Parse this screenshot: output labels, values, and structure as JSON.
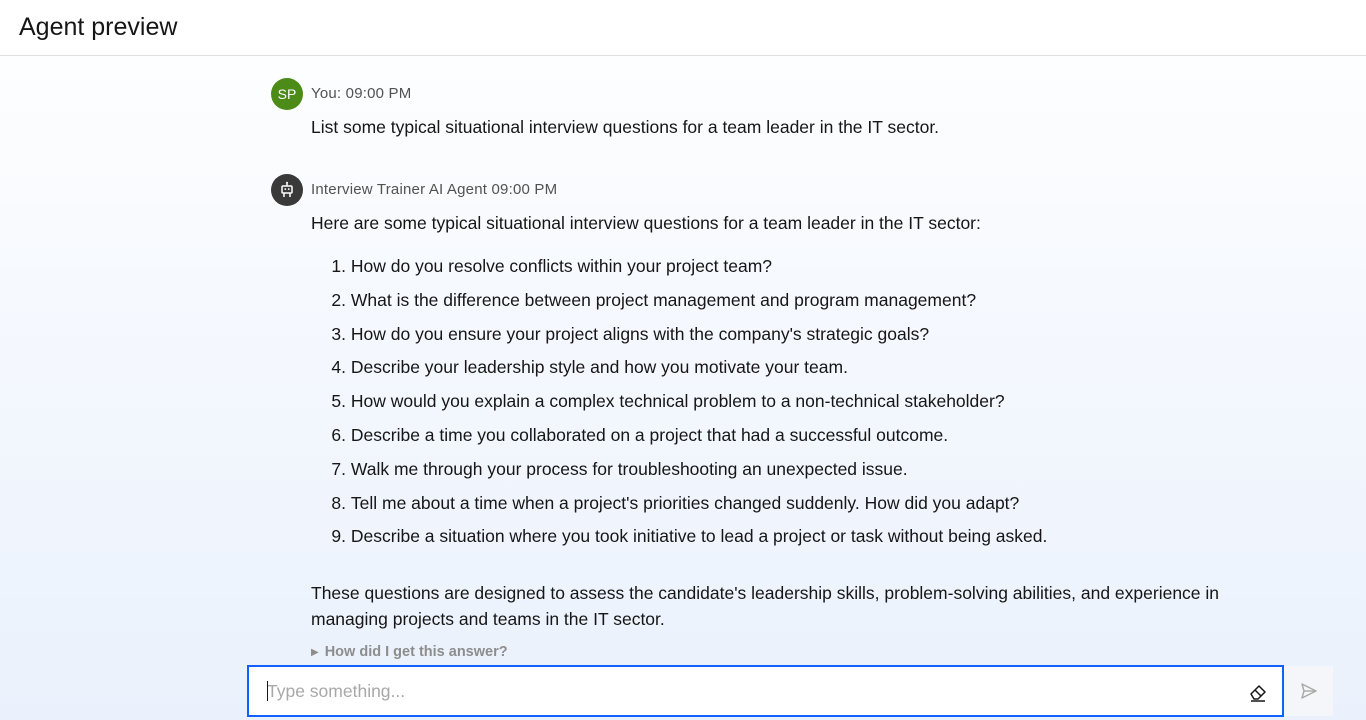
{
  "header": {
    "title": "Agent preview"
  },
  "chat": {
    "user": {
      "initials": "SP",
      "meta": "You: 09:00 PM",
      "message": "List some typical situational interview questions for a team leader in the IT sector."
    },
    "bot": {
      "icon": "robot-icon",
      "meta": "Interview Trainer AI Agent 09:00 PM",
      "intro": "Here are some typical situational interview questions for a team leader in the IT sector:",
      "questions": [
        {
          "num": "1.",
          "text": "How do you resolve conflicts within your project team?"
        },
        {
          "num": "2.",
          "text": "What is the difference between project management and program management?"
        },
        {
          "num": "3.",
          "text": "How do you ensure your project aligns with the company's strategic goals?"
        },
        {
          "num": "4.",
          "text": "Describe your leadership style and how you motivate your team."
        },
        {
          "num": "5.",
          "text": "How would you explain a complex technical problem to a non-technical stakeholder?"
        },
        {
          "num": "6.",
          "text": "Describe a time you collaborated on a project that had a successful outcome."
        },
        {
          "num": "7.",
          "text": "Walk me through your process for troubleshooting an unexpected issue."
        },
        {
          "num": "8.",
          "text": "Tell me about a time when a project's priorities changed suddenly. How did you adapt?"
        },
        {
          "num": "9.",
          "text": "Describe a situation where you took initiative to lead a project or task without being asked."
        }
      ],
      "summary": "These questions are designed to assess the candidate's leadership skills, problem-solving abilities, and experience in managing projects and teams in the IT sector.",
      "explain_label": "How did I get this answer?"
    }
  },
  "composer": {
    "placeholder": "Type something...",
    "value": "",
    "clear_icon": "eraser-icon",
    "send_icon": "send-icon"
  },
  "colors": {
    "accent": "#0f62fe",
    "user_avatar": "#4c8b18",
    "bot_avatar": "#393939"
  }
}
